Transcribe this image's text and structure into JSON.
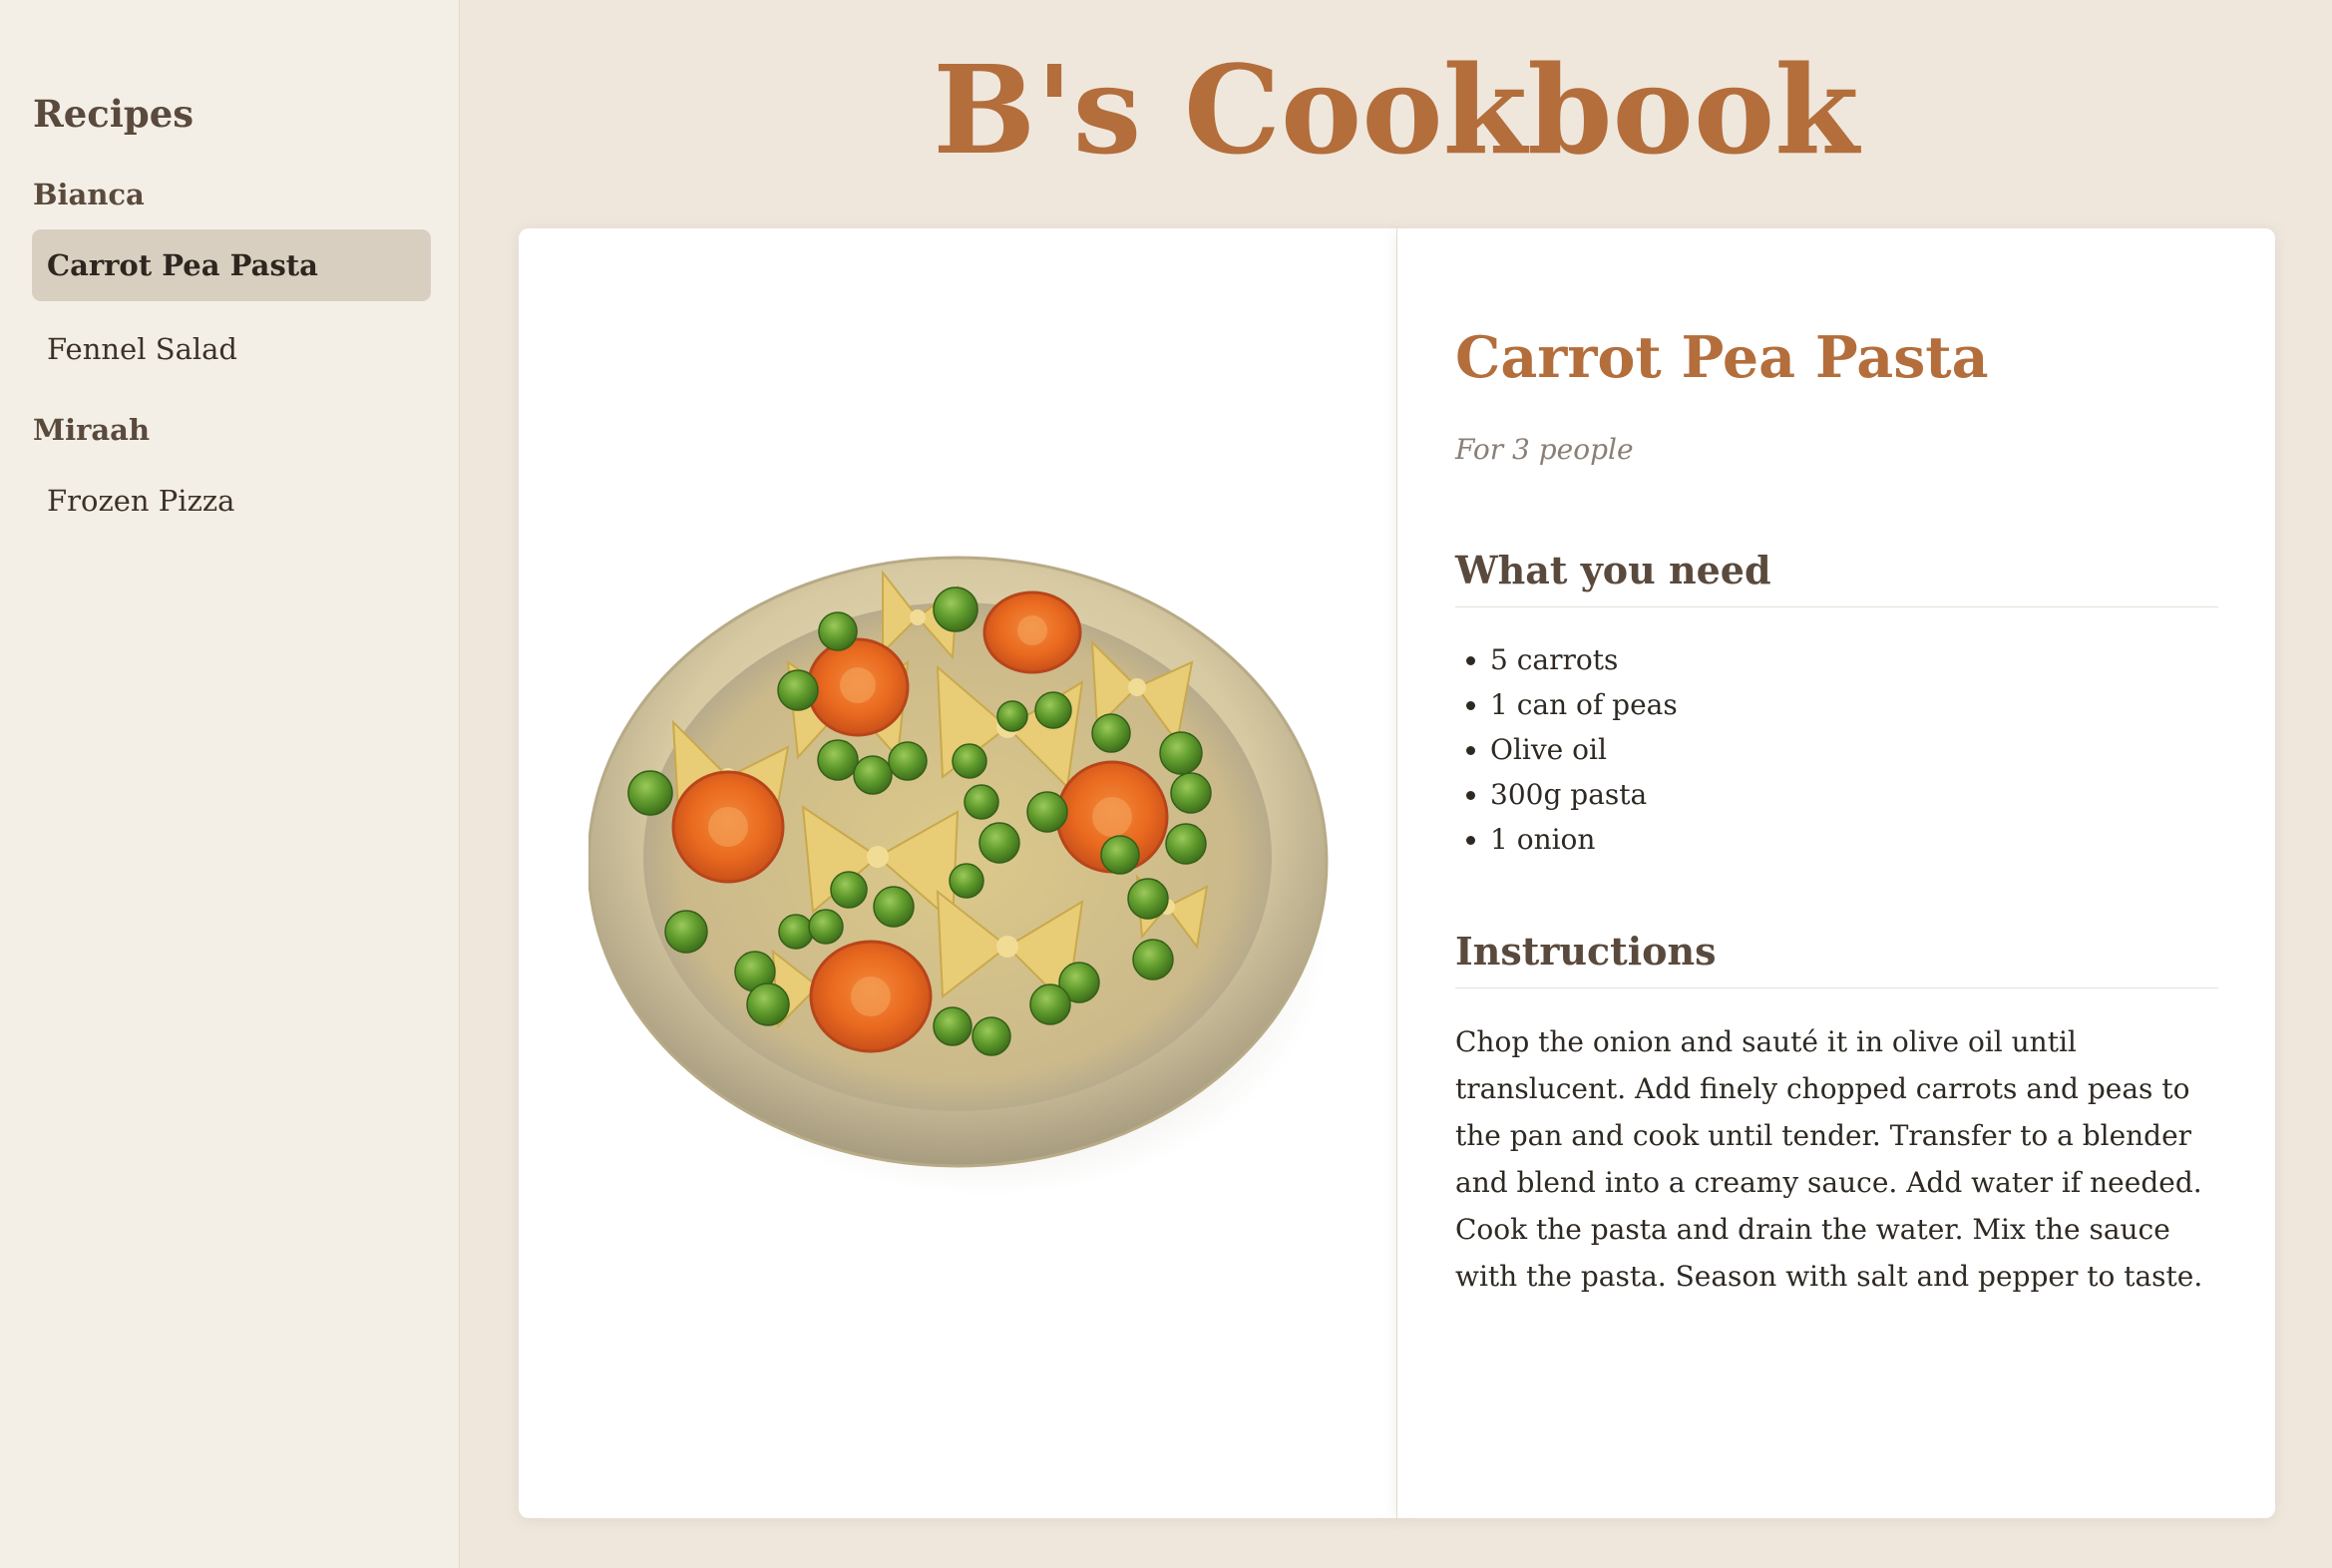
{
  "site": {
    "title": "B's Cookbook"
  },
  "sidebar": {
    "heading": "Recipes",
    "groups": [
      {
        "author": "Bianca",
        "items": [
          {
            "label": "Carrot Pea Pasta",
            "active": true
          },
          {
            "label": "Fennel Salad",
            "active": false
          }
        ]
      },
      {
        "author": "Miraah",
        "items": [
          {
            "label": "Frozen Pizza",
            "active": false
          }
        ]
      }
    ]
  },
  "recipe": {
    "title": "Carrot Pea Pasta",
    "servings": "For 3 people",
    "ingredients_heading": "What you need",
    "ingredients": [
      "5 carrots",
      "1 can of peas",
      "Olive oil",
      "300g pasta",
      "1 onion"
    ],
    "instructions_heading": "Instructions",
    "instructions": "Chop the onion and sauté it in olive oil until translucent. Add finely chopped carrots and peas to the pan and cook until tender. Transfer to a blender and blend into a creamy sauce. Add water if needed. Cook the pasta and drain the water. Mix the sauce with the pasta. Season with salt and pepper to taste."
  },
  "colors": {
    "accent": "#b36e3c",
    "background": "#efe7dc",
    "sidebar": "#f4efe6",
    "active_item": "#d9cfc1"
  },
  "image": {
    "icon": "pasta-bowl-illustration"
  }
}
